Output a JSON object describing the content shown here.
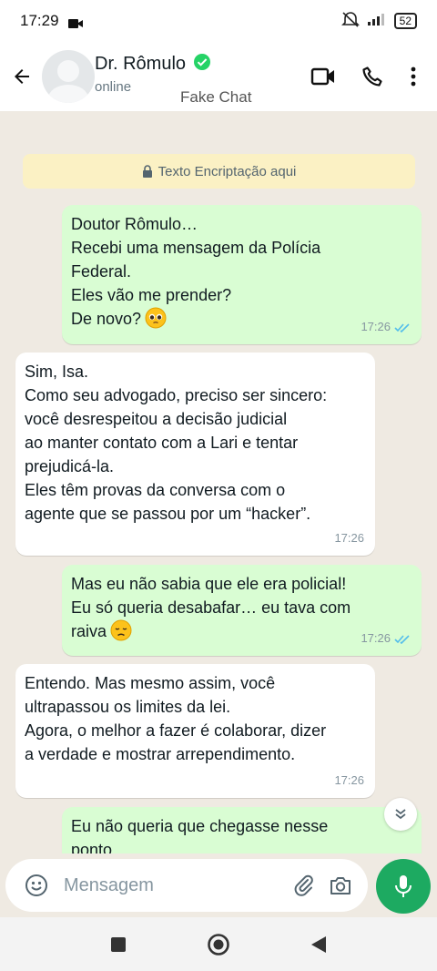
{
  "status_bar": {
    "time": "17:29",
    "battery": "52"
  },
  "header": {
    "name": "Dr. Rômulo",
    "status": "online",
    "watermark": "Fake Chat"
  },
  "chat": {
    "encryption_notice": "Texto Encriptação aqui",
    "messages": [
      {
        "direction": "out",
        "lines": [
          "Doutor Rômulo…",
          "Recebi uma mensagem da Polícia",
          "Federal.",
          "Eles vão me prender?",
          "De novo?"
        ],
        "emoji": "pleading-face",
        "time": "17:26",
        "read": true
      },
      {
        "direction": "in",
        "lines": [
          "Sim, Isa.",
          "Como seu advogado, preciso ser sincero:",
          "você desrespeitou a decisão judicial",
          "ao manter contato com a Lari e tentar",
          "prejudicá-la.",
          "Eles têm provas da conversa com o",
          "agente que se passou por um “hacker”."
        ],
        "time": "17:26"
      },
      {
        "direction": "out",
        "lines": [
          "Mas eu não sabia que ele era policial!",
          "Eu só queria desabafar… eu tava com",
          "raiva"
        ],
        "emoji": "disappointed-face",
        "time": "17:26",
        "read": true
      },
      {
        "direction": "in",
        "lines": [
          "Entendo. Mas mesmo assim, você",
          "ultrapassou os limites da lei.",
          "Agora, o melhor a fazer é colaborar, dizer",
          "a verdade e mostrar arrependimento."
        ],
        "time": "17:26"
      },
      {
        "direction": "out",
        "lines": [
          "Eu não queria que chegasse nesse",
          "ponto…"
        ],
        "time": ""
      }
    ]
  },
  "composer": {
    "placeholder": "Mensagem"
  },
  "colors": {
    "outgoing_bubble": "#d9fdd3",
    "incoming_bubble": "#ffffff",
    "chat_background": "#efeae2",
    "accent_green": "#1daa61",
    "read_ticks": "#53bdeb"
  }
}
